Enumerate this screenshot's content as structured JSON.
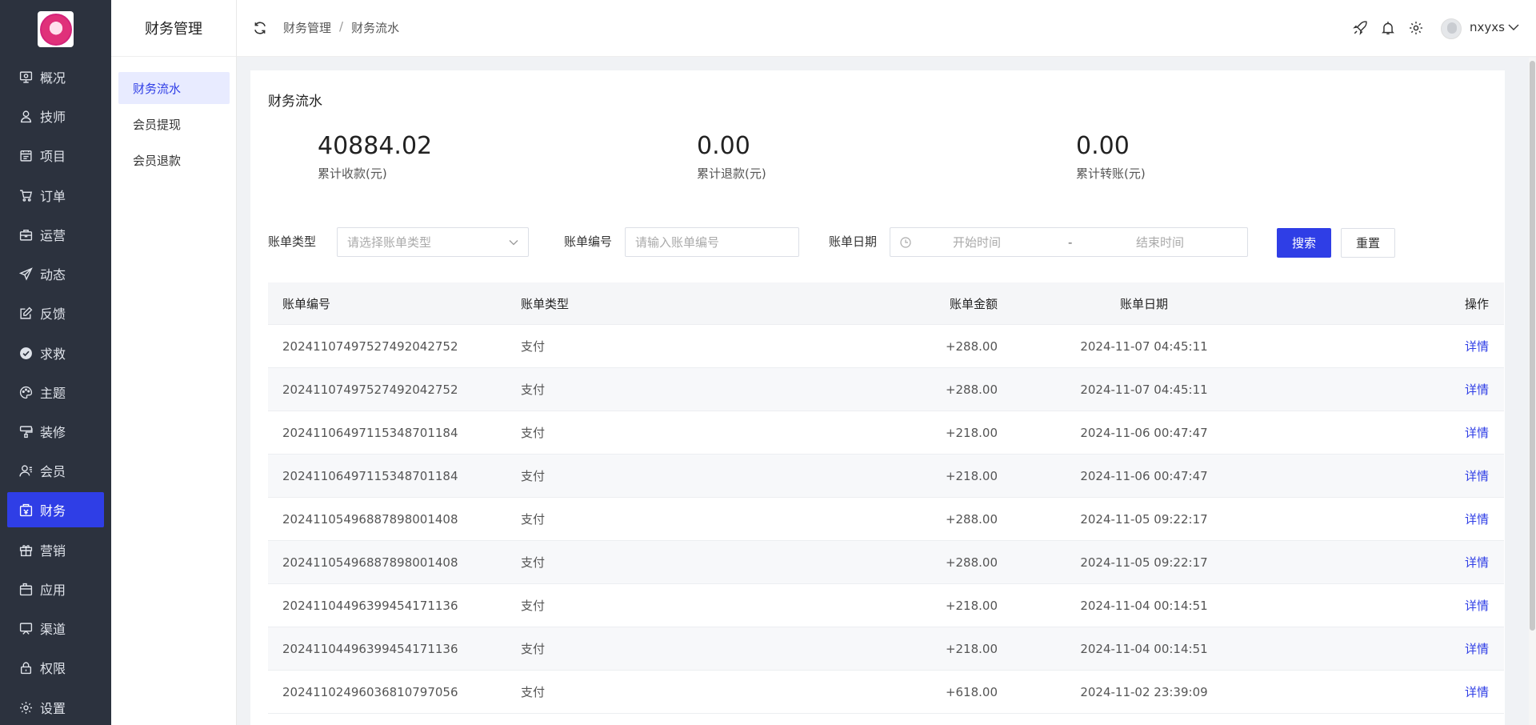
{
  "sidebar": {
    "items": [
      {
        "label": "概况",
        "icon": "dashboard-icon"
      },
      {
        "label": "技师",
        "icon": "user-icon"
      },
      {
        "label": "项目",
        "icon": "calendar-icon"
      },
      {
        "label": "订单",
        "icon": "cart-icon"
      },
      {
        "label": "运营",
        "icon": "briefcase-icon"
      },
      {
        "label": "动态",
        "icon": "send-icon"
      },
      {
        "label": "反馈",
        "icon": "edit-icon"
      },
      {
        "label": "求救",
        "icon": "check-circle-icon"
      },
      {
        "label": "主题",
        "icon": "palette-icon"
      },
      {
        "label": "装修",
        "icon": "brush-icon"
      },
      {
        "label": "会员",
        "icon": "member-icon"
      },
      {
        "label": "财务",
        "icon": "wallet-icon",
        "active": true
      },
      {
        "label": "营销",
        "icon": "gift-icon"
      },
      {
        "label": "应用",
        "icon": "app-icon"
      },
      {
        "label": "渠道",
        "icon": "channel-icon"
      },
      {
        "label": "权限",
        "icon": "lock-icon"
      },
      {
        "label": "设置",
        "icon": "gear-icon"
      }
    ]
  },
  "submenu": {
    "title": "财务管理",
    "items": [
      "财务流水",
      "会员提现",
      "会员退款"
    ]
  },
  "header": {
    "breadcrumb": [
      "财务管理",
      "财务流水"
    ],
    "username": "nxyxs"
  },
  "main": {
    "title": "财务流水",
    "stats": [
      {
        "value": "40884.02",
        "label": "累计收款(元)"
      },
      {
        "value": "0.00",
        "label": "累计退款(元)"
      },
      {
        "value": "0.00",
        "label": "累计转账(元)"
      }
    ],
    "filters": {
      "type_label": "账单类型",
      "type_placeholder": "请选择账单类型",
      "no_label": "账单编号",
      "no_placeholder": "请输入账单编号",
      "date_label": "账单日期",
      "date_start": "开始时间",
      "date_sep": "-",
      "date_end": "结束时间",
      "search": "搜索",
      "reset": "重置"
    },
    "table": {
      "columns": [
        "账单编号",
        "账单类型",
        "账单金额",
        "账单日期",
        "操作"
      ],
      "rows": [
        {
          "id": "2024110749752749204275​2",
          "type": "支付",
          "amount": "+288.00",
          "date": "2024-11-07 04:45:11",
          "action": "详情"
        },
        {
          "id": "20241107497527492042752",
          "type": "支付",
          "amount": "+288.00",
          "date": "2024-11-07 04:45:11",
          "action": "详情"
        },
        {
          "id": "20241106497115348701184",
          "type": "支付",
          "amount": "+218.00",
          "date": "2024-11-06 00:47:47",
          "action": "详情"
        },
        {
          "id": "20241106497115348701184",
          "type": "支付",
          "amount": "+218.00",
          "date": "2024-11-06 00:47:47",
          "action": "详情"
        },
        {
          "id": "20241105496887898001408",
          "type": "支付",
          "amount": "+288.00",
          "date": "2024-11-05 09:22:17",
          "action": "详情"
        },
        {
          "id": "20241105496887898001408",
          "type": "支付",
          "amount": "+288.00",
          "date": "2024-11-05 09:22:17",
          "action": "详情"
        },
        {
          "id": "20241104496399454171136",
          "type": "支付",
          "amount": "+218.00",
          "date": "2024-11-04 00:14:51",
          "action": "详情"
        },
        {
          "id": "20241104496399454171136",
          "type": "支付",
          "amount": "+218.00",
          "date": "2024-11-04 00:14:51",
          "action": "详情"
        },
        {
          "id": "20241102496036810797056",
          "type": "支付",
          "amount": "+618.00",
          "date": "2024-11-02 23:39:09",
          "action": "详情"
        }
      ]
    }
  },
  "colors": {
    "accent": "#2f3ee6",
    "sidebar_bg": "#2c323e"
  }
}
